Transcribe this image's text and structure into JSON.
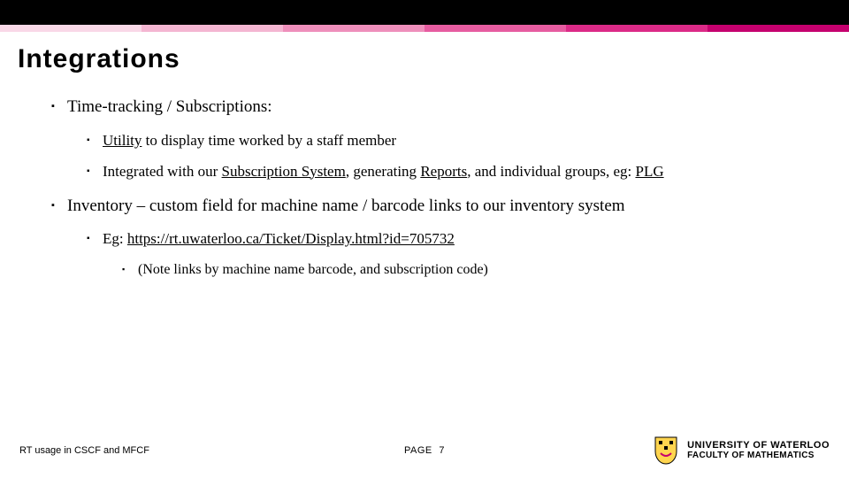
{
  "header": {
    "title": "Integrations"
  },
  "bullets": {
    "b1": "Time-tracking / Subscriptions:",
    "b1a_link": "Utility",
    "b1a_rest": " to display time worked by a staff member",
    "b1b_pre": "Integrated with our ",
    "b1b_sub": "Subscription System",
    "b1b_mid1": ", generating ",
    "b1b_rep": "Reports",
    "b1b_mid2": ", and individual groups, eg: ",
    "b1b_plg": "PLG",
    "b2": "Inventory – custom field for machine name / barcode links to our inventory system",
    "b2a_pre": "Eg: ",
    "b2a_url": "https://rt.uwaterloo.ca/Ticket/Display.html?id=705732",
    "b2a1": "(Note links by machine name barcode, and subscription code)"
  },
  "footer": {
    "left": "RT usage in CSCF and MFCF",
    "page_label": "PAGE",
    "page_number": "7",
    "university_top": "UNIVERSITY OF WATERLOO",
    "university_bottom": "FACULTY OF MATHEMATICS"
  }
}
